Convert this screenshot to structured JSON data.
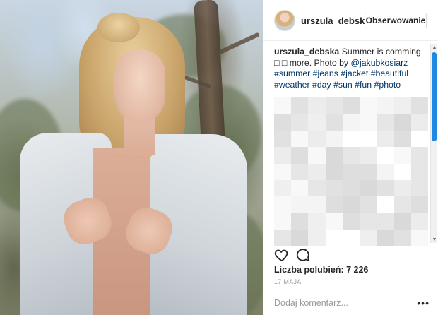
{
  "header": {
    "username": "urszula_debska",
    "follow_label": "Obserwowanie"
  },
  "caption": {
    "username": "urszula_debska",
    "text": "Summer is comming □ □ more. Photo by",
    "mention": "@jakubkosiarz",
    "hashtags": "#summer #jeans #jacket #beautiful #weather #day #sun #fun #photo"
  },
  "icons": {
    "like": "heart-icon",
    "comment": "speech-bubble-icon",
    "more": "ellipsis-icon"
  },
  "likes_text": "Liczba polubień: 7 226",
  "date_text": "17 MAJA",
  "add_comment_placeholder": "Dodaj komentarz...",
  "more_label": "•••",
  "colors": {
    "link": "#003569",
    "scrollbar_thumb": "#1e88e5",
    "button_border": "#dbdbdb"
  }
}
